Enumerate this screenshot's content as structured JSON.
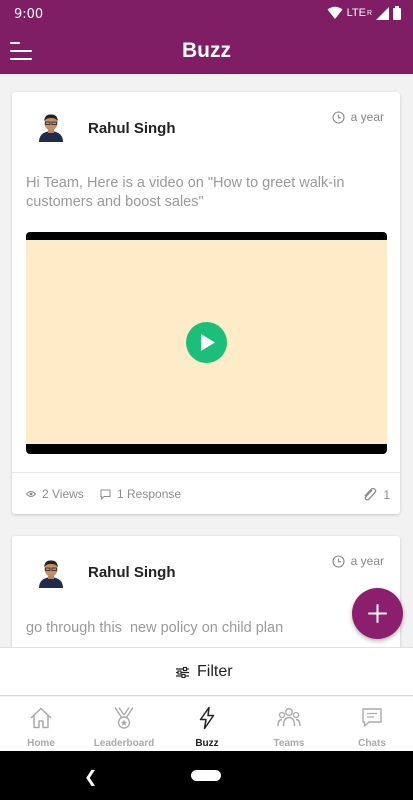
{
  "status_bar": {
    "time": "9:00",
    "network": "LTE",
    "roaming": "R"
  },
  "app_bar": {
    "title": "Buzz"
  },
  "posts": [
    {
      "author": "Rahul Singh",
      "time": "a year",
      "text": "Hi Team, Here is a video on \"How to greet walk-in customers and boost sales\"",
      "views": "2 Views",
      "responses": "1 Response",
      "attachments": "1"
    },
    {
      "author": "Rahul Singh",
      "time": "a year",
      "text": "go through this  new policy on child plan"
    }
  ],
  "filter": {
    "label": "Filter"
  },
  "bottom_nav": [
    {
      "label": "Home",
      "icon": "home-icon"
    },
    {
      "label": "Leaderboard",
      "icon": "medal-icon"
    },
    {
      "label": "Buzz",
      "icon": "lightning-icon"
    },
    {
      "label": "Teams",
      "icon": "people-icon"
    },
    {
      "label": "Chats",
      "icon": "chat-icon"
    }
  ],
  "active_tab": "Buzz",
  "colors": {
    "primary": "#7f1d65",
    "fab": "#8c1f6d",
    "play": "#1bbf7a",
    "video_bg": "#feebc8"
  }
}
